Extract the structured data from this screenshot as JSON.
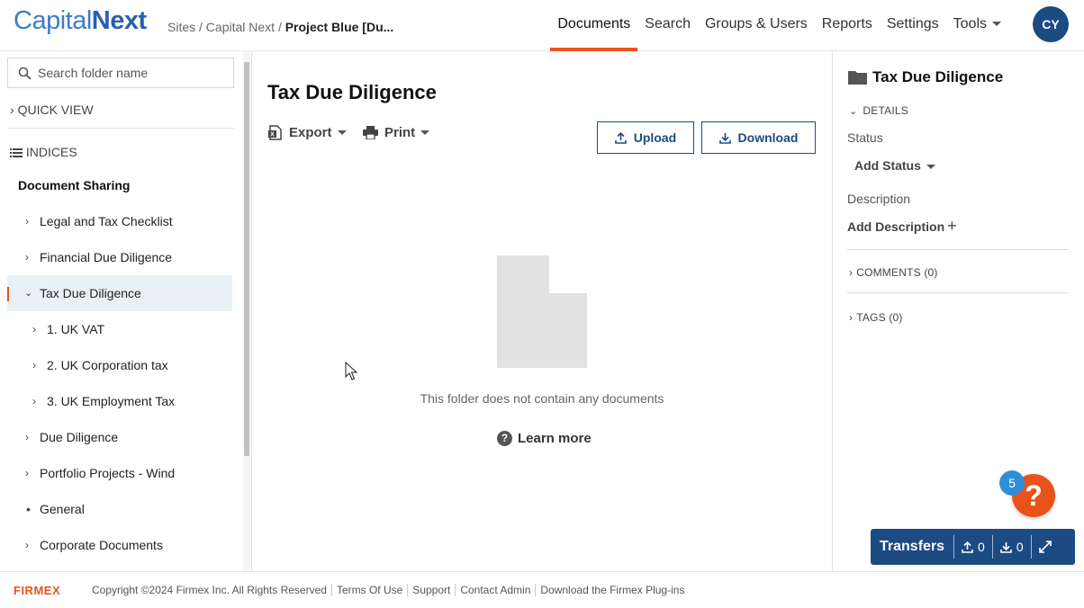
{
  "header": {
    "logo_part1": "Capital",
    "logo_part2": "Next",
    "breadcrumb_prefix": "Sites / Capital Next /",
    "breadcrumb_current": "Project Blue [Du...",
    "nav": [
      "Documents",
      "Search",
      "Groups & Users",
      "Reports",
      "Settings",
      "Tools"
    ],
    "active_nav": "Documents",
    "avatar_initials": "CY"
  },
  "sidebar": {
    "search_placeholder": "Search folder name",
    "quick_view": "QUICK VIEW",
    "indices": "INDICES",
    "root": "Document Sharing",
    "items": [
      {
        "label": "Legal and Tax Checklist",
        "level": 1,
        "marker": "chevron"
      },
      {
        "label": "Financial Due Diligence",
        "level": 1,
        "marker": "chevron"
      },
      {
        "label": "Tax Due Diligence",
        "level": 1,
        "marker": "expanded",
        "selected": true
      },
      {
        "label": "1. UK VAT",
        "level": 2,
        "marker": "chevron"
      },
      {
        "label": "2. UK Corporation tax",
        "level": 2,
        "marker": "chevron"
      },
      {
        "label": "3. UK Employment Tax",
        "level": 2,
        "marker": "chevron"
      },
      {
        "label": "Due Diligence",
        "level": 1,
        "marker": "chevron"
      },
      {
        "label": "Portfolio Projects - Wind",
        "level": 1,
        "marker": "chevron"
      },
      {
        "label": "General",
        "level": 1,
        "marker": "bullet"
      },
      {
        "label": "Corporate Documents",
        "level": 1,
        "marker": "chevron"
      }
    ]
  },
  "main": {
    "title": "Tax Due Diligence",
    "export_label": "Export",
    "print_label": "Print",
    "upload_label": "Upload",
    "download_label": "Download",
    "empty_message": "This folder does not contain any documents",
    "learn_more": "Learn more"
  },
  "details_panel": {
    "title": "Tax Due Diligence",
    "details_label": "DETAILS",
    "status_label": "Status",
    "status_value": "Add Status",
    "description_label": "Description",
    "description_value": "Add Description",
    "comments_label": "COMMENTS (0)",
    "tags_label": "TAGS (0)"
  },
  "help": {
    "badge_count": "5",
    "symbol": "?"
  },
  "transfers": {
    "label": "Transfers",
    "upload_count": "0",
    "download_count": "0"
  },
  "footer": {
    "logo": "FIRMEX",
    "links": [
      "Copyright ©2024 Firmex Inc. All Rights Reserved",
      "Terms Of Use",
      "Support",
      "Contact Admin",
      "Download the Firmex Plug-ins"
    ]
  },
  "colors": {
    "accent": "#e8531c",
    "primary": "#1c4b82",
    "selected_row": "#eaf1f4"
  }
}
